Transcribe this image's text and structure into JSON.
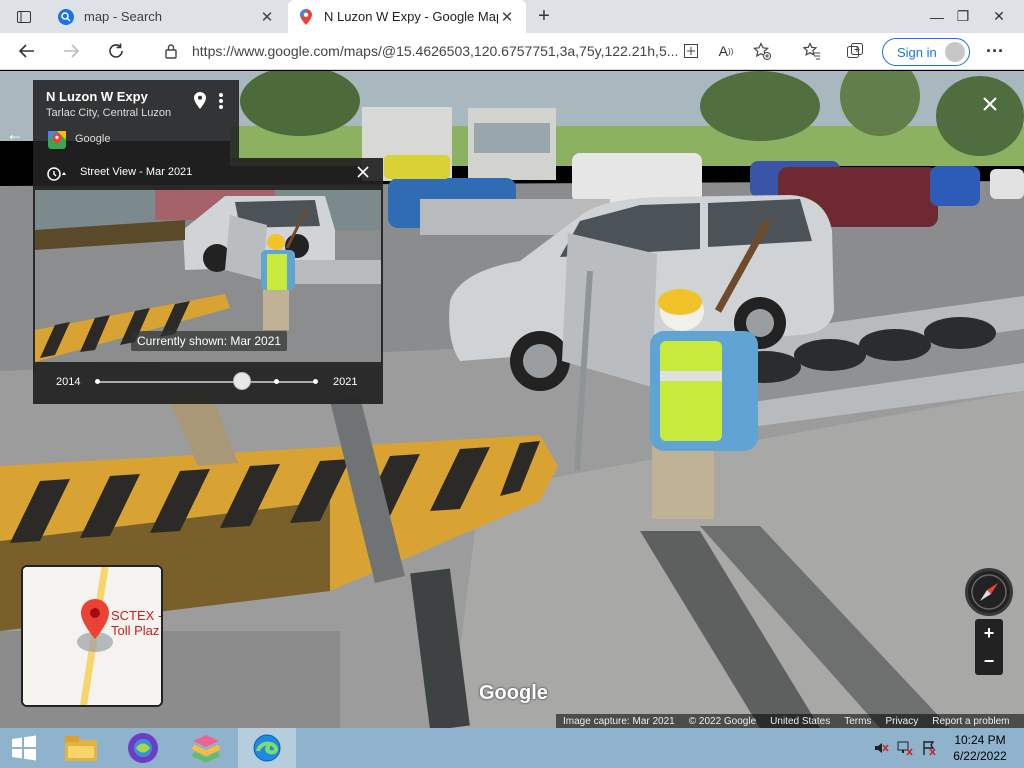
{
  "browser": {
    "tabs": [
      {
        "title": "map - Search",
        "icon": "search-icon"
      },
      {
        "title": "N Luzon W Expy - Google Maps",
        "icon": "google-maps-icon"
      }
    ],
    "url": "https://www.google.com/maps/@15.4626503,120.6757751,3a,75y,122.21h,5...",
    "sign_in_label": "Sign in"
  },
  "place": {
    "title": "N Luzon W Expy",
    "subtitle": "Tarlac City, Central Luzon",
    "provider": "Google"
  },
  "time_machine": {
    "header": "Street View - Mar 2021",
    "currently_shown": "Currently shown: Mar 2021",
    "start_year": "2014",
    "end_year": "2021",
    "selected_fraction": 0.66
  },
  "minimap": {
    "label_line1": "SCTEX -",
    "label_line2": "Toll Plaz"
  },
  "watermark": "Google",
  "footer": [
    "Image capture: Mar 2021",
    "© 2022 Google",
    "United States",
    "Terms",
    "Privacy",
    "Report a problem"
  ],
  "controls": {
    "zoom_in": "+",
    "zoom_out": "−"
  },
  "taskbar": {
    "time": "10:24 PM",
    "date": "6/22/2022",
    "apps": [
      "start-icon",
      "file-explorer-icon",
      "app-icon",
      "bluestacks-icon",
      "edge-icon"
    ]
  }
}
